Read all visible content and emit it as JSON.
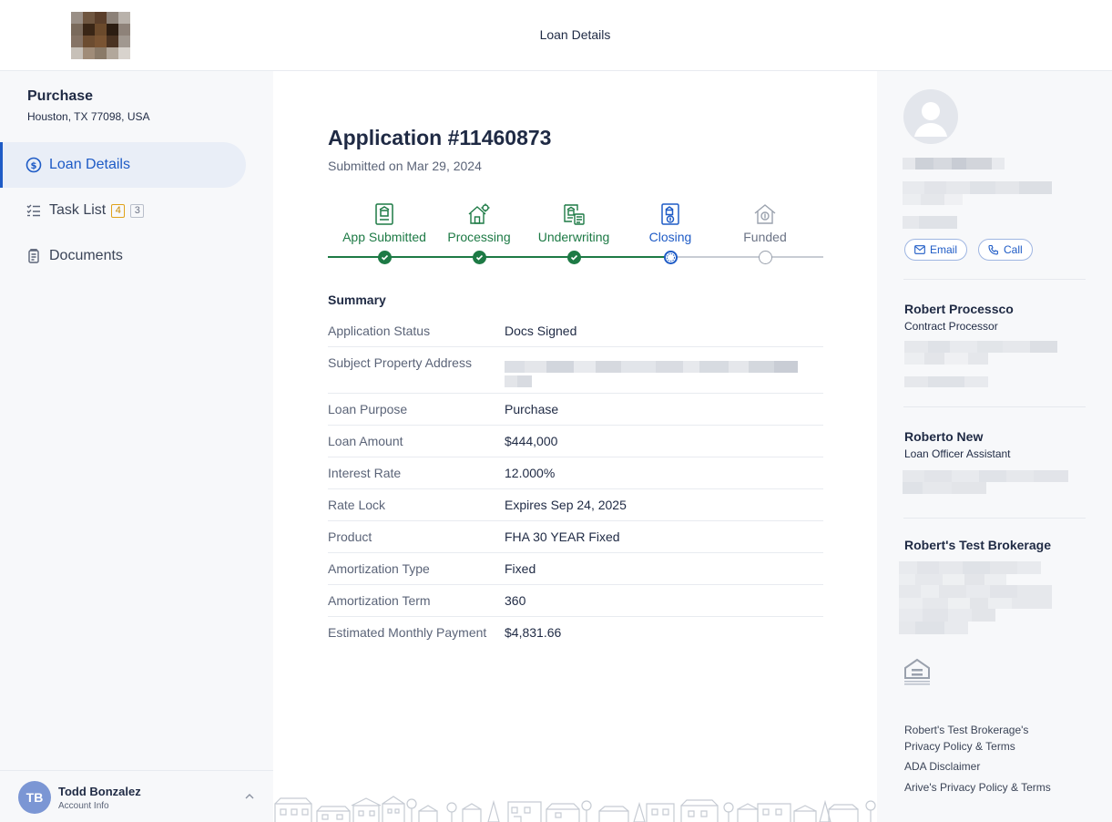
{
  "header": {
    "title": "Loan Details"
  },
  "sidebar": {
    "loan_type": "Purchase",
    "location": "Houston, TX 77098, USA",
    "nav": [
      {
        "label": "Loan Details",
        "icon": "dollar-circle-icon",
        "active": true
      },
      {
        "label": "Task List",
        "icon": "checklist-icon",
        "badge_open": "4",
        "badge_done": "3"
      },
      {
        "label": "Documents",
        "icon": "document-icon"
      }
    ],
    "account": {
      "initials": "TB",
      "name": "Todd Bonzalez",
      "subtitle": "Account Info"
    }
  },
  "application": {
    "title": "Application #11460873",
    "submitted": "Submitted on Mar 29, 2024",
    "steps": [
      {
        "label": "App Submitted",
        "status": "complete"
      },
      {
        "label": "Processing",
        "status": "complete"
      },
      {
        "label": "Underwriting",
        "status": "complete"
      },
      {
        "label": "Closing",
        "status": "current"
      },
      {
        "label": "Funded",
        "status": "pending"
      }
    ],
    "summary_heading": "Summary",
    "summary": [
      {
        "label": "Application Status",
        "value": "Docs Signed"
      },
      {
        "label": "Subject Property Address",
        "value": ""
      },
      {
        "label": "Loan Purpose",
        "value": "Purchase"
      },
      {
        "label": "Loan Amount",
        "value": "$444,000"
      },
      {
        "label": "Interest Rate",
        "value": "12.000%"
      },
      {
        "label": "Rate Lock",
        "value": "Expires Sep 24, 2025"
      },
      {
        "label": "Product",
        "value": "FHA 30 YEAR Fixed"
      },
      {
        "label": "Amortization Type",
        "value": "Fixed"
      },
      {
        "label": "Amortization Term",
        "value": "360"
      },
      {
        "label": "Estimated Monthly Payment",
        "value": "$4,831.66"
      }
    ]
  },
  "contacts": {
    "email_label": "Email",
    "call_label": "Call",
    "processor": {
      "name": "Robert Processco",
      "role": "Contract Processor"
    },
    "assistant": {
      "name": "Roberto New",
      "role": "Loan Officer Assistant"
    },
    "brokerage": {
      "name": "Robert's Test Brokerage"
    }
  },
  "footer_links": {
    "privacy_line1": "Robert's Test Brokerage's",
    "privacy_line2": "Privacy Policy & Terms",
    "ada": "ADA Disclaimer",
    "arive": "Arive's Privacy Policy & Terms"
  },
  "colors": {
    "accent": "#1e5bc6",
    "complete": "#1d7a45",
    "pending": "#9aa1ad"
  }
}
